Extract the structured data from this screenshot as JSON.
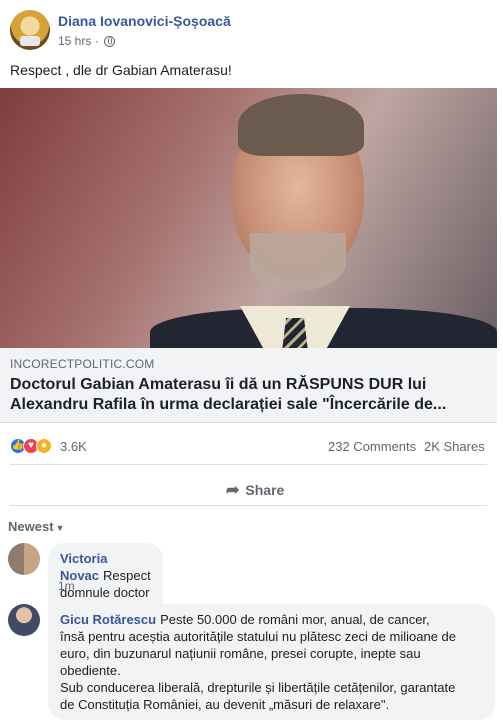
{
  "post": {
    "author": "Diana Iovanovici-Șoșoacă",
    "time": "15 hrs",
    "separator": "·",
    "text": "Respect , dle dr Gabian Amaterasu!"
  },
  "link": {
    "domain": "INCORECTPOLITIC.COM",
    "title": "Doctorul Gabian Amaterasu îi dă un RĂSPUNS DUR lui Alexandru Rafila în urma declarației sale \"Încercările de..."
  },
  "stats": {
    "reactions": "3.6K",
    "comments": "232 Comments",
    "shares": "2K Shares"
  },
  "actions": {
    "share": "Share"
  },
  "sort": {
    "label": "Newest"
  },
  "comments": [
    {
      "name": "Victoria Novac",
      "text": "Respect domnule doctor Gabian multă sanatate",
      "age": "1m"
    },
    {
      "name": "Gicu Rotărescu",
      "text_line1": "Peste 50.000 de români mor, anual, de cancer,",
      "text_line2": "însă pentru aceștia autoritățile statului nu plătesc zeci de milioane de",
      "text_line3": "euro, din buzunarul națiunii române, presei corupte, inepte sau",
      "text_line4": "obediente.",
      "text_line5": "Sub conducerea liberală, drepturile și libertățile cetățenilor, garantate",
      "text_line6": "de Constituția României, au devenit „măsuri de relaxare\"."
    }
  ],
  "icons": {
    "globe": "globe-icon",
    "share": "share-arrow-icon",
    "like": "like-reaction-icon",
    "love": "love-reaction-icon",
    "wow": "wow-reaction-icon"
  },
  "colors": {
    "link_blue": "#385898",
    "muted": "#606770",
    "bubble_bg": "#f2f3f5",
    "like_blue": "#1877f2",
    "love_red": "#f33e58",
    "wow_yellow": "#f7b125"
  }
}
